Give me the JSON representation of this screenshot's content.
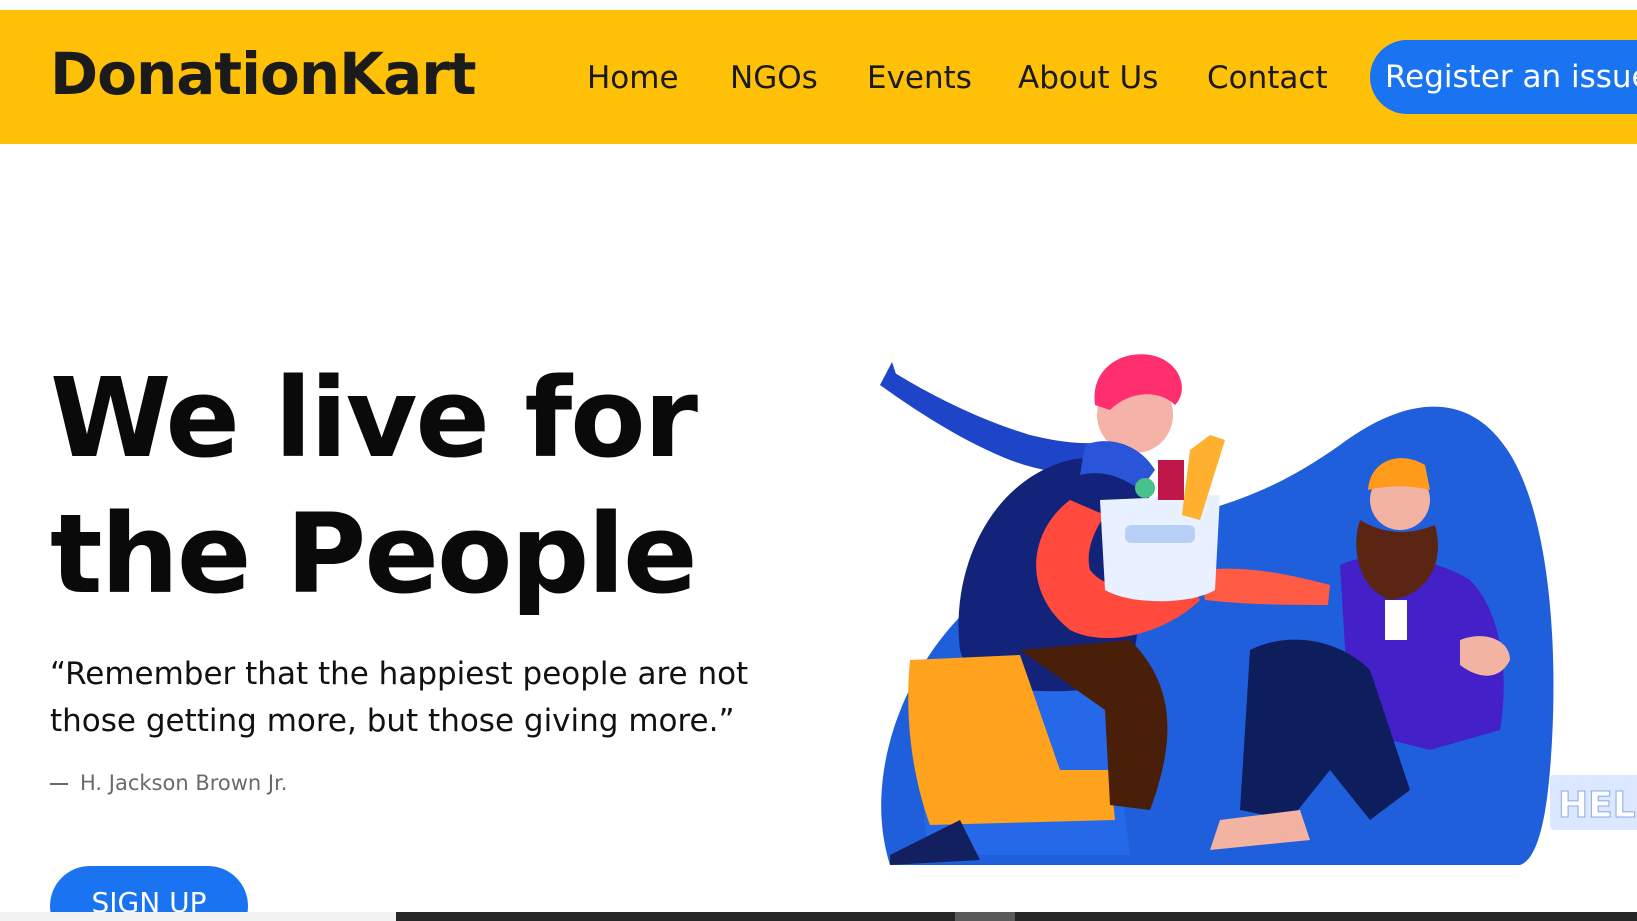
{
  "colors": {
    "navbar_bg": "#FFC107",
    "primary_button": "#1a73f0",
    "text_dark": "#0a0a0a"
  },
  "header": {
    "brand": "DonationKart",
    "nav": {
      "home": "Home",
      "ngos": "NGOs",
      "events": "Events",
      "about": "About Us",
      "contact": "Contact"
    },
    "register_button": "Register an issue"
  },
  "hero": {
    "title_line1": "We live for",
    "title_line2": "the People",
    "quote": "“Remember that the happiest people are not those getting more, but those giving more.”",
    "author": "H. Jackson Brown Jr.",
    "signup_button": "SIGN UP"
  },
  "illustration": {
    "sign_text": "HELP"
  }
}
